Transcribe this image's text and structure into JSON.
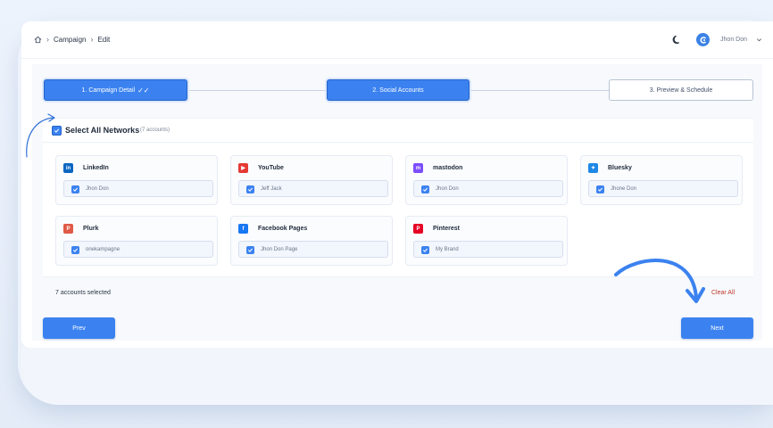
{
  "breadcrumb": {
    "home_icon": "home-icon",
    "items": [
      "Campaign",
      "Edit"
    ]
  },
  "header": {
    "user_name": "Jhon Don",
    "theme_icon": "moon-icon",
    "brand_icon": "brand-logo-icon"
  },
  "stepper": {
    "steps": [
      {
        "label": "1. Campaign Detail",
        "state": "done"
      },
      {
        "label": "2. Social Accounts",
        "state": "active"
      },
      {
        "label": "3. Preview & Schedule",
        "state": "upcoming"
      }
    ],
    "done_mark": "✓✓"
  },
  "networks": {
    "select_all_label": "Select All Networks",
    "count_label": "(7 accounts)",
    "select_all_checked": true,
    "items": [
      {
        "name": "LinkedIn",
        "icon": "linkedin-icon",
        "color": "#0a66c2",
        "glyph": "in",
        "account": "Jhon Don",
        "checked": true
      },
      {
        "name": "YouTube",
        "icon": "youtube-icon",
        "color": "#e53935",
        "glyph": "▶",
        "account": "Jeff Jack",
        "checked": true
      },
      {
        "name": "mastodon",
        "icon": "mastodon-icon",
        "color": "#7c4dff",
        "glyph": "m",
        "account": "Jhon Don",
        "checked": true
      },
      {
        "name": "Bluesky",
        "icon": "bluesky-icon",
        "color": "#1e88e5",
        "glyph": "✦",
        "account": "Jhone Don",
        "checked": true
      },
      {
        "name": "Plurk",
        "icon": "plurk-icon",
        "color": "#e05a47",
        "glyph": "P",
        "account": "onekampagne",
        "checked": true
      },
      {
        "name": "Facebook Pages",
        "icon": "facebook-icon",
        "color": "#1877f2",
        "glyph": "f",
        "account": "Jhon Don Page",
        "checked": true
      },
      {
        "name": "Pinterest",
        "icon": "pinterest-icon",
        "color": "#e60023",
        "glyph": "P",
        "account": "My Brand",
        "checked": true
      }
    ]
  },
  "footer": {
    "selected_label": "7 accounts selected",
    "clear_all_label": "Clear All"
  },
  "nav": {
    "prev_label": "Prev",
    "next_label": "Next"
  },
  "colors": {
    "primary": "#3b82f0",
    "danger": "#c0392b",
    "annotation_arrow": "#3b82f0"
  }
}
